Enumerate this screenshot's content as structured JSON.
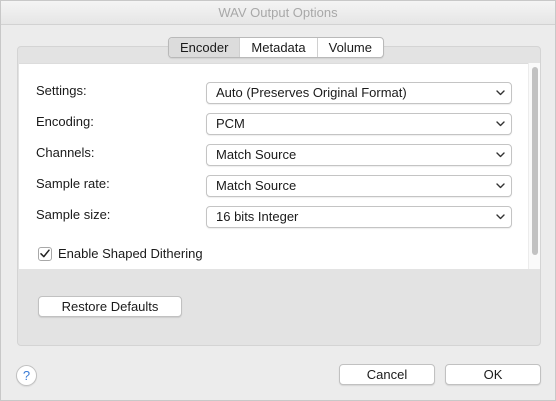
{
  "window": {
    "title": "WAV Output Options"
  },
  "tabs": [
    {
      "label": "Encoder",
      "active": true
    },
    {
      "label": "Metadata",
      "active": false
    },
    {
      "label": "Volume",
      "active": false
    }
  ],
  "fields": [
    {
      "label": "Settings:",
      "value": "Auto (Preserves Original Format)"
    },
    {
      "label": "Encoding:",
      "value": "PCM"
    },
    {
      "label": "Channels:",
      "value": "Match Source"
    },
    {
      "label": "Sample rate:",
      "value": "Match Source"
    },
    {
      "label": "Sample size:",
      "value": "16 bits Integer"
    }
  ],
  "dithering": {
    "label": "Enable Shaped Dithering",
    "checked": true
  },
  "buttons": {
    "restore_defaults": "Restore Defaults",
    "cancel": "Cancel",
    "ok": "OK",
    "help": "?"
  },
  "colors": {
    "help_icon": "#3a7bd5",
    "tab_active_bg": "#dcdcdc"
  }
}
